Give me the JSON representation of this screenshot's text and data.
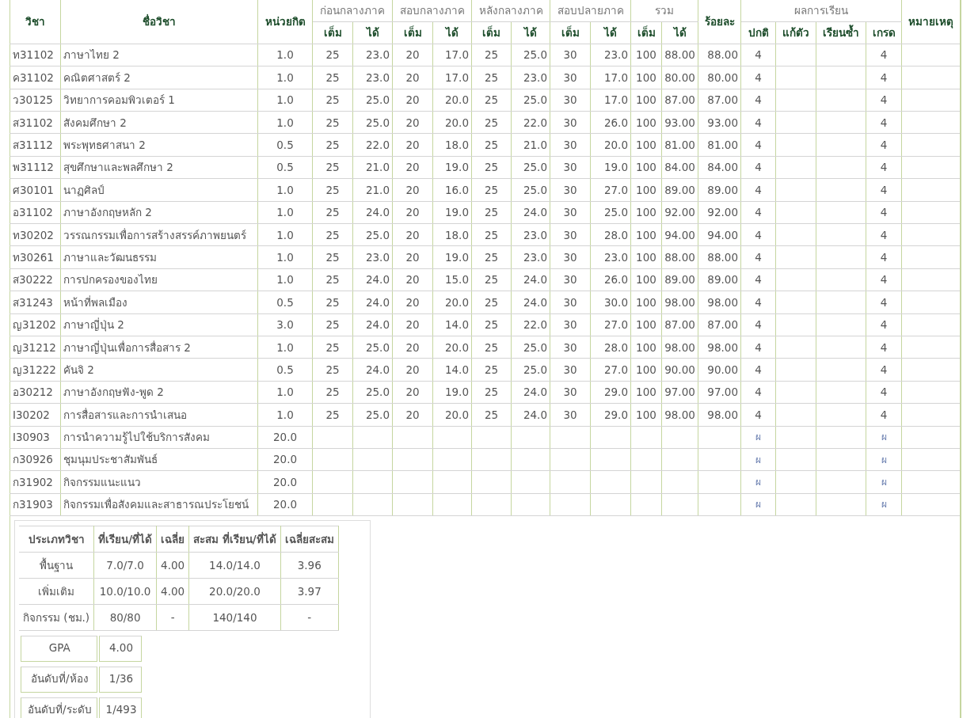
{
  "header": {
    "code": "วิชา",
    "name": "ชื่อวิชา",
    "credit": "หน่วยกิต",
    "score_groups": [
      {
        "label": "ก่อนกลางภาค",
        "sub": [
          "เต็ม",
          "ได้"
        ]
      },
      {
        "label": "สอบกลางภาค",
        "sub": [
          "เต็ม",
          "ได้"
        ]
      },
      {
        "label": "หลังกลางภาค",
        "sub": [
          "เต็ม",
          "ได้"
        ]
      },
      {
        "label": "สอบปลายภาค",
        "sub": [
          "เต็ม",
          "ได้"
        ]
      },
      {
        "label": "รวม",
        "sub": [
          "เต็ม",
          "ได้"
        ]
      }
    ],
    "percent": "ร้อยละ",
    "result_group": {
      "label": "ผลการเรียน",
      "sub": [
        "ปกติ",
        "แก้ตัว",
        "เรียนซ้ำ",
        "เกรด"
      ]
    },
    "note": "หมายเหตุ"
  },
  "rows": [
    {
      "kind": "subject",
      "code": "ท31102",
      "name": "ภาษาไทย 2",
      "credit": "1.0",
      "scores": [
        "25",
        "23.0",
        "20",
        "17.0",
        "25",
        "25.0",
        "30",
        "23.0",
        "100",
        "88.00"
      ],
      "percent": "88.00",
      "normal": "4",
      "grade": "4"
    },
    {
      "kind": "subject",
      "code": "ค31102",
      "name": "คณิตศาสตร์ 2",
      "credit": "1.0",
      "scores": [
        "25",
        "23.0",
        "20",
        "17.0",
        "25",
        "23.0",
        "30",
        "17.0",
        "100",
        "80.00"
      ],
      "percent": "80.00",
      "normal": "4",
      "grade": "4"
    },
    {
      "kind": "subject",
      "code": "ว30125",
      "name": "วิทยาการคอมพิวเตอร์ 1",
      "credit": "1.0",
      "scores": [
        "25",
        "25.0",
        "20",
        "20.0",
        "25",
        "25.0",
        "30",
        "17.0",
        "100",
        "87.00"
      ],
      "percent": "87.00",
      "normal": "4",
      "grade": "4"
    },
    {
      "kind": "subject",
      "code": "ส31102",
      "name": "สังคมศึกษา 2",
      "credit": "1.0",
      "scores": [
        "25",
        "25.0",
        "20",
        "20.0",
        "25",
        "22.0",
        "30",
        "26.0",
        "100",
        "93.00"
      ],
      "percent": "93.00",
      "normal": "4",
      "grade": "4"
    },
    {
      "kind": "subject",
      "code": "ส31112",
      "name": "พระพุทธศาสนา 2",
      "credit": "0.5",
      "scores": [
        "25",
        "22.0",
        "20",
        "18.0",
        "25",
        "21.0",
        "30",
        "20.0",
        "100",
        "81.00"
      ],
      "percent": "81.00",
      "normal": "4",
      "grade": "4"
    },
    {
      "kind": "subject",
      "code": "พ31112",
      "name": "สุขศึกษาและพลศึกษา 2",
      "credit": "0.5",
      "scores": [
        "25",
        "21.0",
        "20",
        "19.0",
        "25",
        "25.0",
        "30",
        "19.0",
        "100",
        "84.00"
      ],
      "percent": "84.00",
      "normal": "4",
      "grade": "4"
    },
    {
      "kind": "subject",
      "code": "ศ30101",
      "name": "นาฏศิลป์",
      "credit": "1.0",
      "scores": [
        "25",
        "21.0",
        "20",
        "16.0",
        "25",
        "25.0",
        "30",
        "27.0",
        "100",
        "89.00"
      ],
      "percent": "89.00",
      "normal": "4",
      "grade": "4"
    },
    {
      "kind": "subject",
      "code": "อ31102",
      "name": "ภาษาอังกฤษหลัก 2",
      "credit": "1.0",
      "scores": [
        "25",
        "24.0",
        "20",
        "19.0",
        "25",
        "24.0",
        "30",
        "25.0",
        "100",
        "92.00"
      ],
      "percent": "92.00",
      "normal": "4",
      "grade": "4"
    },
    {
      "kind": "subject",
      "code": "ท30202",
      "name": "วรรณกรรมเพื่อการสร้างสรรค์ภาพยนตร์",
      "credit": "1.0",
      "scores": [
        "25",
        "25.0",
        "20",
        "18.0",
        "25",
        "23.0",
        "30",
        "28.0",
        "100",
        "94.00"
      ],
      "percent": "94.00",
      "normal": "4",
      "grade": "4"
    },
    {
      "kind": "subject",
      "code": "ท30261",
      "name": "ภาษาและวัฒนธรรม",
      "credit": "1.0",
      "scores": [
        "25",
        "23.0",
        "20",
        "19.0",
        "25",
        "23.0",
        "30",
        "23.0",
        "100",
        "88.00"
      ],
      "percent": "88.00",
      "normal": "4",
      "grade": "4"
    },
    {
      "kind": "subject",
      "code": "ส30222",
      "name": "การปกครองของไทย",
      "credit": "1.0",
      "scores": [
        "25",
        "24.0",
        "20",
        "15.0",
        "25",
        "24.0",
        "30",
        "26.0",
        "100",
        "89.00"
      ],
      "percent": "89.00",
      "normal": "4",
      "grade": "4"
    },
    {
      "kind": "subject",
      "code": "ส31243",
      "name": "หน้าที่พลเมือง",
      "credit": "0.5",
      "scores": [
        "25",
        "24.0",
        "20",
        "20.0",
        "25",
        "24.0",
        "30",
        "30.0",
        "100",
        "98.00"
      ],
      "percent": "98.00",
      "normal": "4",
      "grade": "4"
    },
    {
      "kind": "subject",
      "code": "ญ31202",
      "name": "ภาษาญี่ปุ่น 2",
      "credit": "3.0",
      "scores": [
        "25",
        "24.0",
        "20",
        "14.0",
        "25",
        "22.0",
        "30",
        "27.0",
        "100",
        "87.00"
      ],
      "percent": "87.00",
      "normal": "4",
      "grade": "4"
    },
    {
      "kind": "subject",
      "code": "ญ31212",
      "name": "ภาษาญี่ปุ่นเพื่อการสื่อสาร 2",
      "credit": "1.0",
      "scores": [
        "25",
        "25.0",
        "20",
        "20.0",
        "25",
        "25.0",
        "30",
        "28.0",
        "100",
        "98.00"
      ],
      "percent": "98.00",
      "normal": "4",
      "grade": "4"
    },
    {
      "kind": "subject",
      "code": "ญ31222",
      "name": "คันจิ 2",
      "credit": "0.5",
      "scores": [
        "25",
        "24.0",
        "20",
        "14.0",
        "25",
        "25.0",
        "30",
        "27.0",
        "100",
        "90.00"
      ],
      "percent": "90.00",
      "normal": "4",
      "grade": "4"
    },
    {
      "kind": "subject",
      "code": "อ30212",
      "name": "ภาษาอังกฤษฟัง-พูด 2",
      "credit": "1.0",
      "scores": [
        "25",
        "25.0",
        "20",
        "19.0",
        "25",
        "24.0",
        "30",
        "29.0",
        "100",
        "97.00"
      ],
      "percent": "97.00",
      "normal": "4",
      "grade": "4"
    },
    {
      "kind": "subject",
      "code": "I30202",
      "name": "การสื่อสารและการนำเสนอ",
      "credit": "1.0",
      "scores": [
        "25",
        "25.0",
        "20",
        "20.0",
        "25",
        "24.0",
        "30",
        "29.0",
        "100",
        "98.00"
      ],
      "percent": "98.00",
      "normal": "4",
      "grade": "4"
    },
    {
      "kind": "activity",
      "code": "I30903",
      "name": "การนำความรู้ไปใช้บริการสังคม",
      "credit": "20.0",
      "normal": "ผ",
      "grade": "ผ"
    },
    {
      "kind": "activity",
      "code": "ก30926",
      "name": "ชุมนุมประชาสัมพันธ์",
      "credit": "20.0",
      "normal": "ผ",
      "grade": "ผ"
    },
    {
      "kind": "activity",
      "code": "ก31902",
      "name": "กิจกรรมแนะแนว",
      "credit": "20.0",
      "normal": "ผ",
      "grade": "ผ"
    },
    {
      "kind": "activity",
      "code": "ก31903",
      "name": "กิจกรรมเพื่อสังคมและสาธารณประโยชน์",
      "credit": "20.0",
      "normal": "ผ",
      "grade": "ผ"
    }
  ],
  "summary": {
    "columns": [
      "ประเภทวิชา",
      "ที่เรียน/ที่ได้",
      "เฉลี่ย",
      "สะสม  ที่เรียน/ที่ได้",
      "เฉลี่ยสะสม"
    ],
    "rows": [
      [
        "พื้นฐาน",
        "7.0/7.0",
        "4.00",
        "14.0/14.0",
        "3.96"
      ],
      [
        "เพิ่มเติม",
        "10.0/10.0",
        "4.00",
        "20.0/20.0",
        "3.97"
      ],
      [
        "กิจกรรม (ชม.)",
        "80/80",
        "-",
        "140/140",
        "-"
      ]
    ]
  },
  "standing": [
    {
      "label": "GPA",
      "value": "4.00"
    },
    {
      "label": "อันดับที่/ห้อง",
      "value": "1/36"
    },
    {
      "label": "อันดับที่/ระดับ",
      "value": "1/493"
    }
  ]
}
